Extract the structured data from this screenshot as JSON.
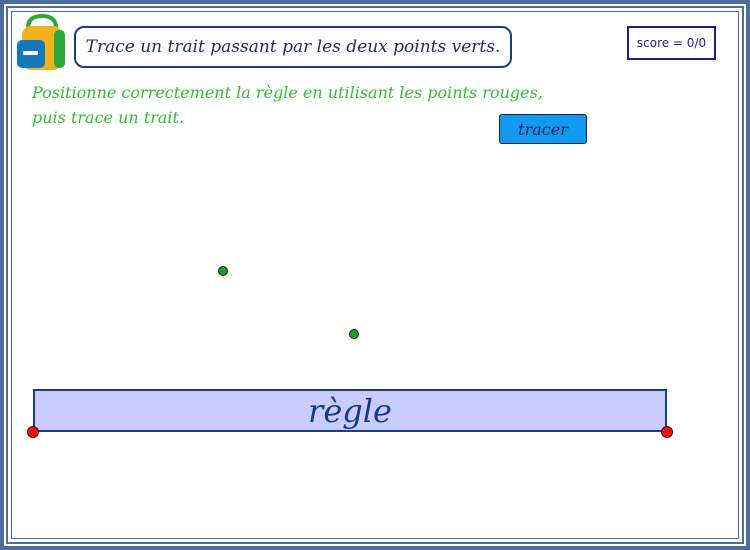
{
  "instruction": "Trace un trait passant par les deux points verts.",
  "score": "score = 0/0",
  "hint": {
    "line1": "Positionne correctement la règle en utilisant les points rouges,",
    "line2": "puis trace un trait."
  },
  "tracer_label": "tracer",
  "ruler_label": "règle",
  "colors": {
    "frame": "#4a6ea1",
    "hint_text": "#2fbf2f",
    "button": "#129af0",
    "ruler_fill": "#c8ccff",
    "green_point": "#1aa01a",
    "red_point": "#ee1111"
  },
  "icons": {
    "logo": "backpack-icon"
  }
}
